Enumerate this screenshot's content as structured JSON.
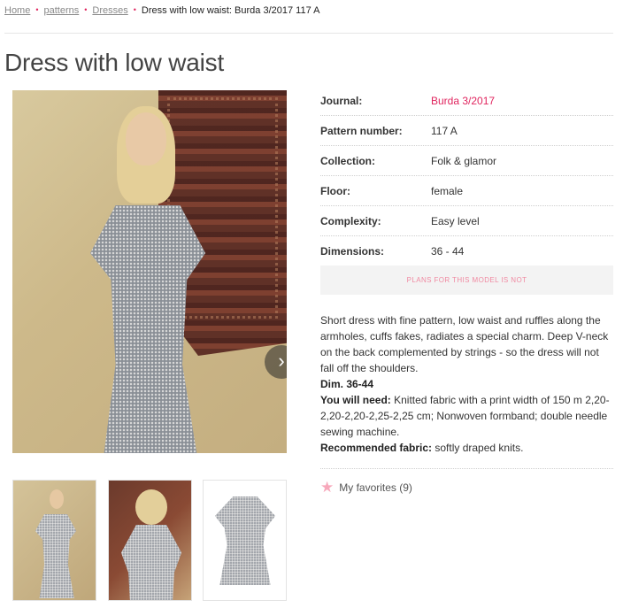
{
  "breadcrumb": {
    "items": [
      "Home",
      "patterns",
      "Dresses"
    ],
    "current": "Dress with low waist: Burda 3/2017 117 A",
    "separator": "•"
  },
  "page_title": "Dress with low waist",
  "details": {
    "journal_label": "Journal:",
    "journal_value": "Burda 3/2017",
    "pattern_label": "Pattern number:",
    "pattern_value": "117 A",
    "collection_label": "Collection:",
    "collection_value": "Folk & glamor",
    "floor_label": "Floor:",
    "floor_value": "female",
    "complexity_label": "Complexity:",
    "complexity_value": "Easy level",
    "dimensions_label": "Dimensions:",
    "dimensions_value": "36 - 44"
  },
  "plans_notice": "PLANS FOR THIS MODEL IS NOT",
  "description": {
    "text": "Short dress with fine pattern, low waist and ruffles along the armholes, cuffs fakes, radiates a special charm. Deep V-neck on the back complemented by strings - so the dress will not fall off the shoulders.",
    "dim": "Dim. 36-44",
    "need_label": "You will need:",
    "need_text": "Knitted fabric with a print width of 150 m 2,20-2,20-2,20-2,25-2,25 cm; Nonwoven formband; double needle sewing machine.",
    "fabric_label": "Recommended fabric:",
    "fabric_text": "softly draped knits."
  },
  "favorites": {
    "label": "My favorites (9)",
    "icon": "star-icon"
  },
  "gallery": {
    "next_icon": "chevron-right-icon",
    "thumbnails": [
      "thumbnail-front",
      "thumbnail-back",
      "thumbnail-flat"
    ]
  },
  "colors": {
    "accent": "#e0245e",
    "notice_text": "#f08aa2",
    "star": "#f7a8bb"
  }
}
